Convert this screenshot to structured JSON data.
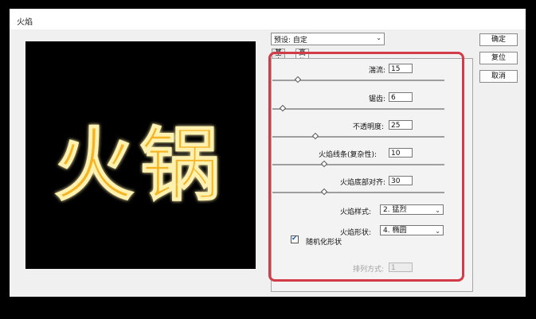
{
  "window": {
    "title": "火焰"
  },
  "preview": {
    "text": "火锅"
  },
  "preset": {
    "label": "预设:",
    "value": "自定"
  },
  "buttons": {
    "ok": "确定",
    "reset": "复位",
    "cancel": "取消"
  },
  "tabs": [
    {
      "label": "基本",
      "active": false
    },
    {
      "label": "高级",
      "active": true
    }
  ],
  "params": [
    {
      "label": "湍流:",
      "value": "15",
      "level": 0.15
    },
    {
      "label": "锯齿:",
      "value": "6",
      "level": 0.06
    },
    {
      "label": "不透明度:",
      "value": "25",
      "level": 0.25
    },
    {
      "label": "火焰线条(复杂性):",
      "value": "10",
      "level": 0.3
    },
    {
      "label": "火焰底部对齐:",
      "value": "30",
      "level": 0.3
    }
  ],
  "flame_style": {
    "label": "火焰样式:",
    "value": "2. 猛烈"
  },
  "flame_shape": {
    "label": "火焰形状:",
    "value": "4. 椭圆"
  },
  "randomize": {
    "label": "随机化形状",
    "checked": true
  },
  "arrangement": {
    "label": "排列方式:",
    "value": "1"
  },
  "colors": {
    "highlight": "#d23b48",
    "flame": "#f5b428",
    "flame_core": "#fff2b0"
  }
}
